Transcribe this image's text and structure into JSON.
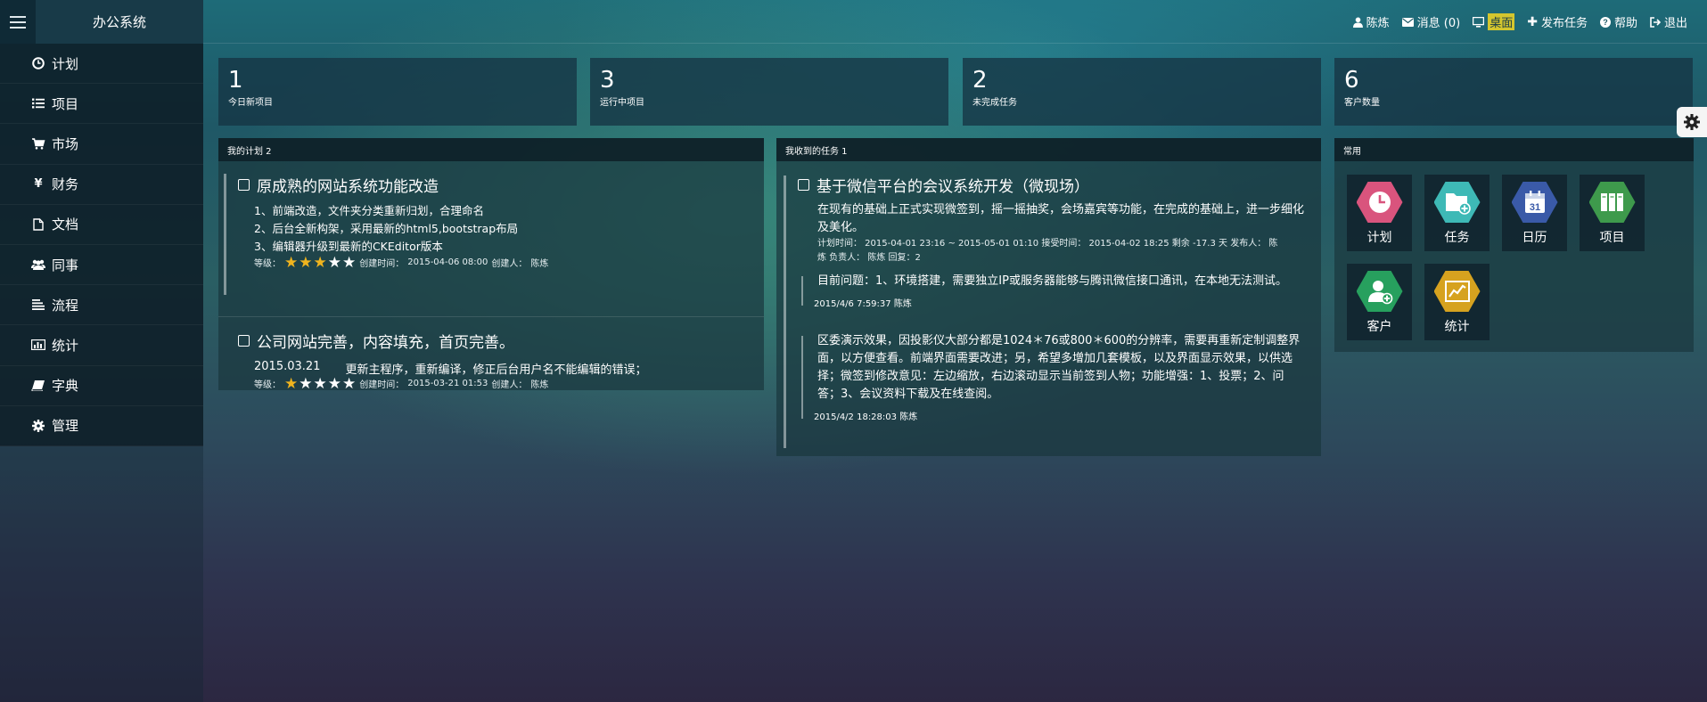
{
  "app": {
    "brand": "办公系统"
  },
  "top_links": [
    {
      "icon": "user-icon",
      "label": "陈炼"
    },
    {
      "icon": "envelope-icon",
      "label": "消息 (0)"
    },
    {
      "icon": "monitor-icon",
      "label": "桌面"
    },
    {
      "icon": "plus-icon",
      "label": "发布任务"
    },
    {
      "icon": "help-icon",
      "label": "帮助"
    },
    {
      "icon": "logout-icon",
      "label": "退出"
    }
  ],
  "sidebar": {
    "items": [
      {
        "icon": "clock-icon",
        "label": "计划"
      },
      {
        "icon": "list-icon",
        "label": "项目"
      },
      {
        "icon": "cart-icon",
        "label": "市场"
      },
      {
        "icon": "yen-icon",
        "label": "财务"
      },
      {
        "icon": "document-icon",
        "label": "文档"
      },
      {
        "icon": "users-icon",
        "label": "同事"
      },
      {
        "icon": "align-icon",
        "label": "流程"
      },
      {
        "icon": "bar-chart-icon",
        "label": "统计"
      },
      {
        "icon": "book-icon",
        "label": "字典"
      },
      {
        "icon": "gear-icon",
        "label": "管理"
      }
    ]
  },
  "stats": [
    {
      "value": "1",
      "label": "今日新项目"
    },
    {
      "value": "3",
      "label": "运行中项目"
    },
    {
      "value": "2",
      "label": "未完成任务"
    },
    {
      "value": "6",
      "label": "客户数量"
    }
  ],
  "plans_panel": {
    "title": "我的计划 2",
    "plans": [
      {
        "title": "原成熟的网站系统功能改造",
        "lines": [
          "1、前端改造，文件夹分类重新归划，合理命名",
          "2、后台全新构架，采用最新的html5,bootstrap布局",
          "3、编辑器升级到最新的CKEditor版本"
        ],
        "level_label": "等级：",
        "rating": 3,
        "created_label": "创建时间：",
        "created": "2015-04-06 08:00",
        "creator_label": "创建人：",
        "creator": "陈炼"
      },
      {
        "title": "公司网站完善，内容填充，首页完善。",
        "date": "2015.03.21",
        "note": "更新主程序，重新编译，修正后台用户名不能编辑的错误；",
        "level_label": "等级：",
        "rating": 1,
        "created_label": "创建时间：",
        "created": "2015-03-21 01:53",
        "creator_label": "创建人：",
        "creator": "陈炼"
      }
    ]
  },
  "tasks_panel": {
    "title": "我收到的任务 1",
    "task": {
      "title": "基于微信平台的会议系统开发（微现场）",
      "description": "在现有的基础上正式实现微签到，摇一摇抽奖，会场嘉宾等功能，在完成的基础上，进一步细化及美化。",
      "meta_line1": "计划时间： 2015-04-01 23:16 ~ 2015-05-01 01:10 接受时间： 2015-04-02 18:25 剩余 -17.3 天 发布人： 陈",
      "meta_line2": "炼 负责人： 陈炼 回复：2",
      "comments": [
        {
          "text": "目前问题：1、环境搭建，需要独立IP或服务器能够与腾讯微信接口通讯，在本地无法测试。",
          "time": "2015/4/6 7:59:37",
          "author": "陈炼"
        },
        {
          "text": "区委演示效果，因投影仪大部分都是1024＊76或800＊600的分辨率，需要再重新定制调整界面，以方便查看。前端界面需要改进；另，希望多增加几套模板，以及界面显示效果，以供选择；微签到修改意见：左边缩放，右边滚动显示当前签到人物；功能增强：1、投票；2、问答；3、会议资料下载及在线查阅。",
          "time": "2015/4/2 18:28:03",
          "author": "陈炼"
        }
      ]
    }
  },
  "common_panel": {
    "title": "常用",
    "tiles": [
      {
        "icon": "clock-icon",
        "label": "计划",
        "color": "#d9547d"
      },
      {
        "icon": "folder-add-icon",
        "label": "任务",
        "color": "#3eb9b6"
      },
      {
        "icon": "calendar-icon",
        "label": "日历",
        "color": "#3a5aa8",
        "day": "31"
      },
      {
        "icon": "books-icon",
        "label": "项目",
        "color": "#3e9a4c"
      },
      {
        "icon": "user-add-icon",
        "label": "客户",
        "color": "#27a05e"
      },
      {
        "icon": "line-chart-icon",
        "label": "统计",
        "color": "#d6a21f"
      }
    ]
  }
}
